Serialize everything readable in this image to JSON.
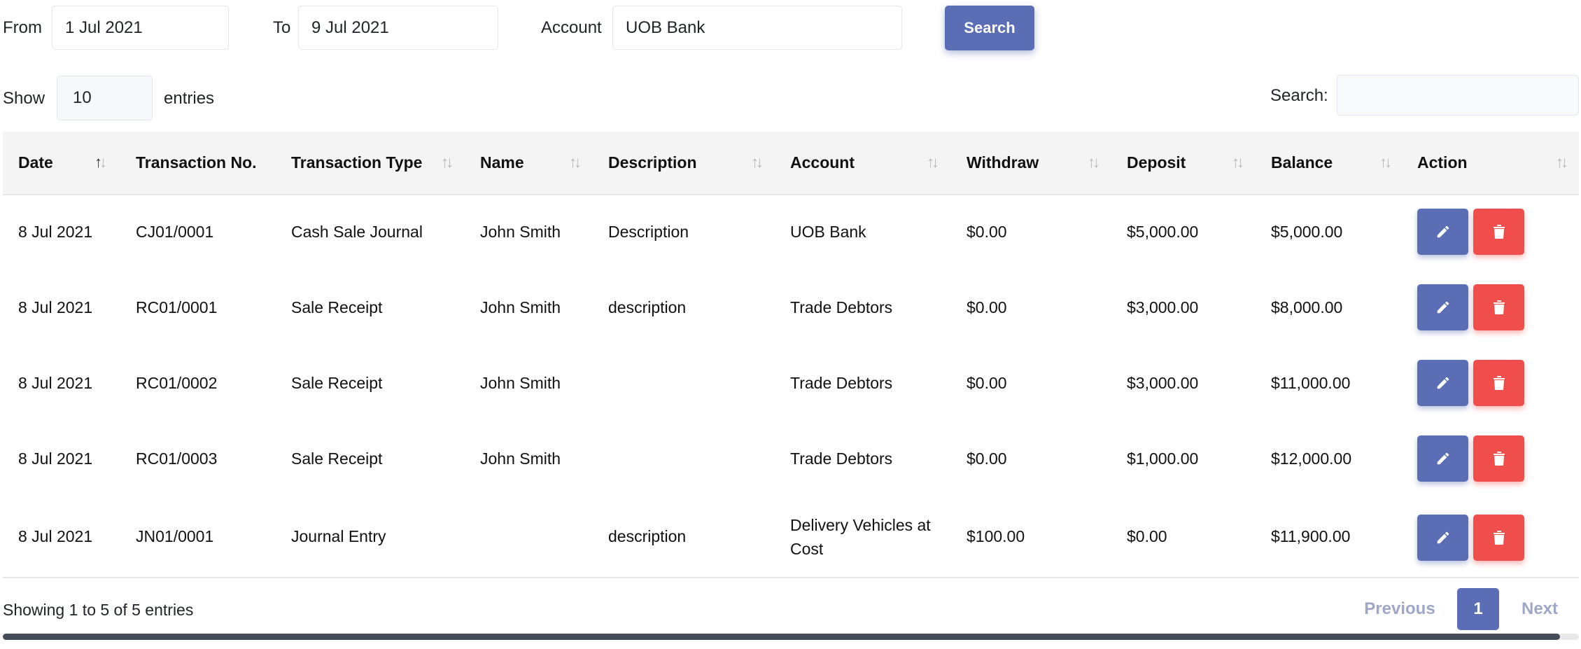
{
  "filters": {
    "from_label": "From",
    "from_value": "1 Jul 2021",
    "to_label": "To",
    "to_value": "9 Jul 2021",
    "account_label": "Account",
    "account_value": "UOB Bank",
    "search_button": "Search"
  },
  "controls": {
    "show_label": "Show",
    "entries_value": "10",
    "entries_label": "entries",
    "search_label": "Search:",
    "search_value": ""
  },
  "table": {
    "headers": [
      "Date",
      "Transaction No.",
      "Transaction Type",
      "Name",
      "Description",
      "Account",
      "Withdraw",
      "Deposit",
      "Balance",
      "Action"
    ],
    "rows": [
      {
        "date": "8 Jul 2021",
        "no": "CJ01/0001",
        "type": "Cash Sale Journal",
        "name": "John Smith",
        "desc": "Description",
        "account": "UOB Bank",
        "withdraw": "$0.00",
        "deposit": "$5,000.00",
        "balance": "$5,000.00"
      },
      {
        "date": "8 Jul 2021",
        "no": "RC01/0001",
        "type": "Sale Receipt",
        "name": "John Smith",
        "desc": "description",
        "account": "Trade Debtors",
        "withdraw": "$0.00",
        "deposit": "$3,000.00",
        "balance": "$8,000.00"
      },
      {
        "date": "8 Jul 2021",
        "no": "RC01/0002",
        "type": "Sale Receipt",
        "name": "John Smith",
        "desc": "",
        "account": "Trade Debtors",
        "withdraw": "$0.00",
        "deposit": "$3,000.00",
        "balance": "$11,000.00"
      },
      {
        "date": "8 Jul 2021",
        "no": "RC01/0003",
        "type": "Sale Receipt",
        "name": "John Smith",
        "desc": "",
        "account": "Trade Debtors",
        "withdraw": "$0.00",
        "deposit": "$1,000.00",
        "balance": "$12,000.00"
      },
      {
        "date": "8 Jul 2021",
        "no": "JN01/0001",
        "type": "Journal Entry",
        "name": "",
        "desc": "description",
        "account": "Delivery Vehicles at Cost",
        "withdraw": "$100.00",
        "deposit": "$0.00",
        "balance": "$11,900.00"
      }
    ]
  },
  "footer": {
    "info": "Showing 1 to 5 of 5 entries",
    "previous": "Previous",
    "page": "1",
    "next": "Next"
  },
  "icons": {
    "edit": "pencil-icon",
    "delete": "trash-icon",
    "sort": "sort-arrows-icon"
  },
  "colors": {
    "primary": "#5b6eb5",
    "danger": "#ef4e4c",
    "header_bg": "#f4f4f4",
    "disabled_text": "#9ea7c8"
  }
}
